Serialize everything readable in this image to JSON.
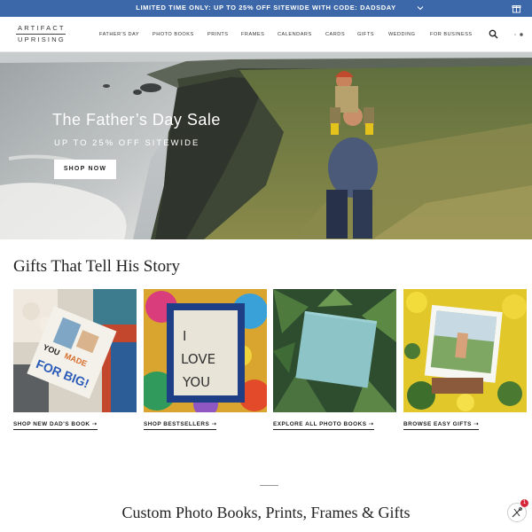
{
  "promo": {
    "text": "LIMITED TIME ONLY: UP TO 25% OFF SITEWIDE WITH CODE: DADSDAY",
    "icons": [
      "chevron-down-icon",
      "gift-icon"
    ]
  },
  "header": {
    "logo_top": "ARTIFACT",
    "logo_bottom": "UPRISING",
    "nav": [
      "FATHER'S DAY",
      "PHOTO BOOKS",
      "PRINTS",
      "FRAMES",
      "CALENDARS",
      "CARDS",
      "GIFTS",
      "WEDDING",
      "FOR BUSINESS"
    ],
    "icons": [
      "search-icon",
      "account-icon"
    ]
  },
  "hero": {
    "title": "The Father’s Day Sale",
    "subtitle": "UP TO 25% OFF SITEWIDE",
    "cta": "SHOP NOW"
  },
  "gifts": {
    "title": "Gifts That Tell His Story",
    "cards": [
      {
        "link": "SHOP NEW DAD'S BOOK ➝",
        "book_text_1": "YOU",
        "book_text_2": "MADE",
        "book_text_3": "FOR BIG!"
      },
      {
        "link": "SHOP BESTSELLERS ➝",
        "art_text": "I LOVE YOU"
      },
      {
        "link": "EXPLORE ALL PHOTO BOOKS ➝"
      },
      {
        "link": "BROWSE EASY GIFTS ➝"
      }
    ]
  },
  "bottom": {
    "title": "Custom Photo Books, Prints, Frames & Gifts"
  },
  "rewards": {
    "badge_count": "1",
    "icon": "rewards-icon"
  },
  "colors": {
    "promo_bar": "#3c67a8",
    "text": "#222222"
  }
}
